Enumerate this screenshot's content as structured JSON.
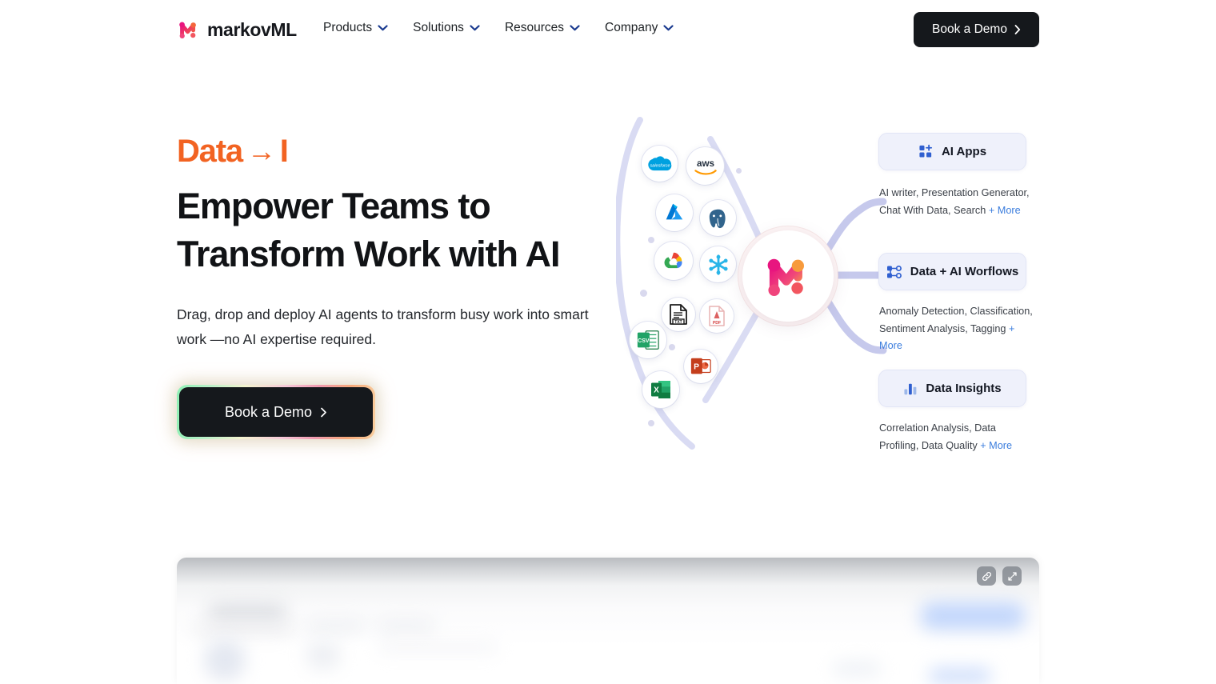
{
  "header": {
    "logo": {
      "icon": "markovml-logo-icon",
      "text": "markovML"
    },
    "nav_items": [
      {
        "label": "Products",
        "icon": "chevron-down-icon"
      },
      {
        "label": "Solutions",
        "icon": "chevron-down-icon"
      },
      {
        "label": "Resources",
        "icon": "chevron-down-icon"
      },
      {
        "label": "Company",
        "icon": "chevron-down-icon"
      }
    ],
    "cta": {
      "label": "Book a Demo",
      "icon": "chevron-right-icon"
    }
  },
  "hero": {
    "eyebrow_prefix": "Data",
    "eyebrow_arrow": "→",
    "eyebrow_typed": "I",
    "headline_line1": "Empower Teams to",
    "headline_line2": "Transform Work with AI",
    "subcopy": "Drag, drop and deploy AI agents to transform busy work into smart work —no AI expertise required.",
    "cta": {
      "label": "Book a Demo",
      "icon": "chevron-right-icon"
    }
  },
  "graphic": {
    "hub": {
      "name": "markovml-hub-logo"
    },
    "sources": [
      {
        "name": "salesforce-icon",
        "label": "salesforce"
      },
      {
        "name": "aws-icon",
        "label": "aws"
      },
      {
        "name": "azure-icon",
        "label": "Azure"
      },
      {
        "name": "postgresql-icon",
        "label": "PostgreSQL"
      },
      {
        "name": "google-cloud-icon",
        "label": "Google Cloud"
      },
      {
        "name": "snowflake-icon",
        "label": "Snowflake"
      },
      {
        "name": "txt-file-icon",
        "label": "TXT"
      },
      {
        "name": "pdf-file-icon",
        "label": "PDF"
      },
      {
        "name": "csv-file-icon",
        "label": "CSV"
      },
      {
        "name": "powerpoint-icon",
        "label": "PowerPoint"
      },
      {
        "name": "excel-icon",
        "label": "Excel"
      }
    ],
    "cards": [
      {
        "title": "AI Apps",
        "icon": "grid-plus-icon",
        "desc_text": "AI writer, Presentation Generator, Chat With Data, Search ",
        "desc_more": "+ More"
      },
      {
        "title": "Data + AI Worflows",
        "icon": "workflow-nodes-icon",
        "desc_text": "Anomaly Detection, Classification, Sentiment Analysis, Tagging ",
        "desc_more": "+ More"
      },
      {
        "title": "Data Insights",
        "icon": "bar-chart-icon",
        "desc_text": "Correlation Analysis, Data Profiling, Data Quality  ",
        "desc_more": "+ More"
      }
    ]
  },
  "preview_panel": {
    "name": "product-demo-preview",
    "buttons": [
      {
        "name": "copy-link-button",
        "icon": "link-icon"
      },
      {
        "name": "fullscreen-button",
        "icon": "expand-icon"
      }
    ]
  },
  "colors": {
    "accent_orange": "#f26322",
    "ink": "#111316",
    "card_bg": "#eff1fb",
    "link_blue": "#3b7ddd",
    "wire": "#c6c9ec"
  }
}
